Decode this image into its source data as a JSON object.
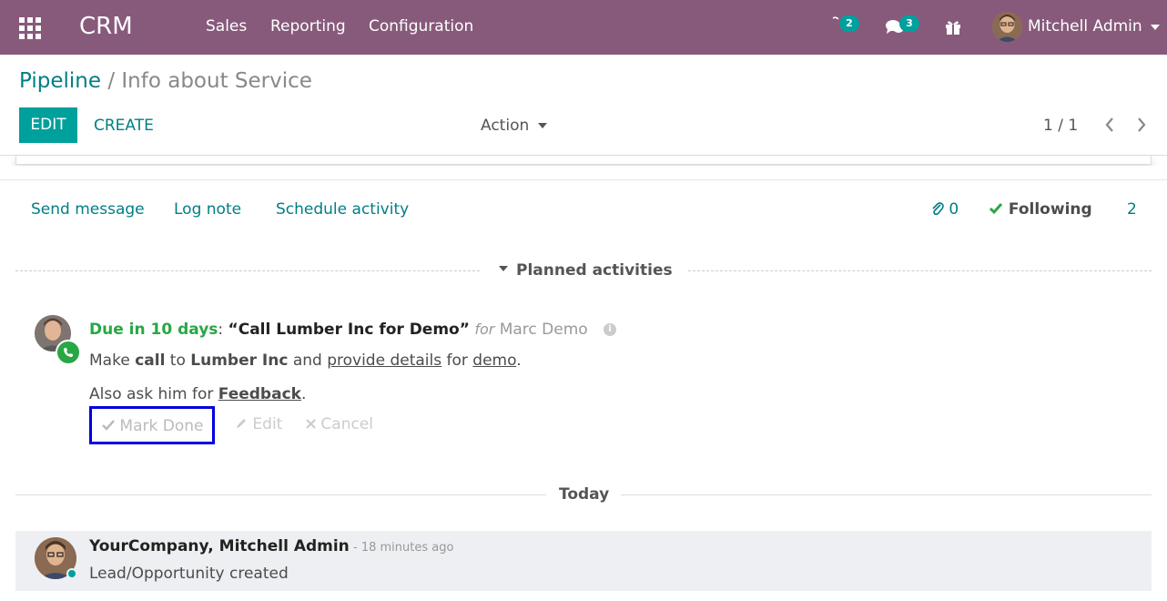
{
  "navbar": {
    "brand": "CRM",
    "menu": [
      "Sales",
      "Reporting",
      "Configuration"
    ],
    "activity_count": "2",
    "messages_count": "3",
    "user_name": "Mitchell Admin"
  },
  "breadcrumb": {
    "parent": "Pipeline",
    "separator": "/",
    "current": "Info about Service"
  },
  "toolbar": {
    "edit_label": "EDIT",
    "create_label": "CREATE",
    "action_label": "Action",
    "pager": "1 / 1"
  },
  "chatter": {
    "send_message": "Send message",
    "log_note": "Log note",
    "schedule_activity": "Schedule activity",
    "attachments_count": "0",
    "following_label": "Following",
    "followers_count": "2",
    "planned_title": "Planned activities",
    "today_label": "Today"
  },
  "activity": {
    "due": "Due in 10 days",
    "colon": ":",
    "summary": "“Call Lumber Inc for Demo”",
    "for_label": "for",
    "assigned_user": "Marc Demo",
    "note_line1": {
      "t1": "Make ",
      "b1": "call",
      "t2": " to ",
      "b2": "Lumber Inc",
      "t3": " and ",
      "u1": "provide details",
      "t4": " for ",
      "u2": "demo",
      "t5": "."
    },
    "note_line2": {
      "t1": "Also ask him for ",
      "bu": "Feedback",
      "t2": "."
    },
    "mark_done_label": "Mark Done",
    "edit_label": "Edit",
    "cancel_label": "Cancel"
  },
  "message": {
    "author": "YourCompany, Mitchell Admin",
    "date": "- 18 minutes ago",
    "body": "Lead/Opportunity created"
  },
  "colors": {
    "navbar": "#875a7b",
    "primary": "#00a09d",
    "link": "#017e84",
    "success": "#28a745",
    "highlight_border": "#0000dd"
  }
}
